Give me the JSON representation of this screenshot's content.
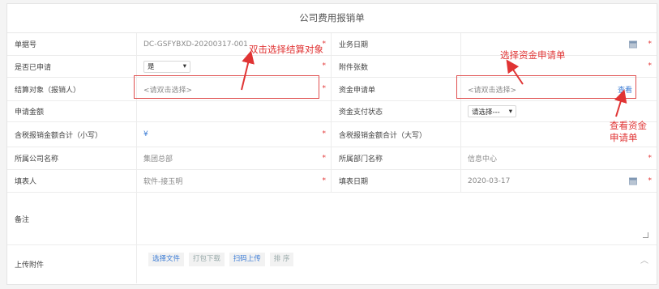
{
  "form_title": "公司费用报销单",
  "rows": {
    "r1": {
      "label_left": "单据号",
      "value_left": "DC-GSFYBXD-20200317-001",
      "label_right": "业务日期",
      "value_right": ""
    },
    "r2": {
      "label_left": "是否已申请",
      "select_value": "是",
      "label_right": "附件张数",
      "value_right": ""
    },
    "r3": {
      "label_left": "结算对象（报销人）",
      "placeholder_left": "<请双击选择>",
      "label_right": "资金申请单",
      "placeholder_right": "<请双击选择>",
      "link_right": "查看"
    },
    "r4": {
      "label_left": "申请金额",
      "label_right": "资金支付状态",
      "select_value": "请选择---"
    },
    "r5": {
      "label_left": "含税报销金额合计（小写）",
      "value_left": "¥",
      "label_right": "含税报销金额合计（大写）"
    },
    "r6": {
      "label_left": "所属公司名称",
      "value_left": "集团总部",
      "label_right": "所属部门名称",
      "value_right": "信息中心"
    },
    "r7": {
      "label_left": "填表人",
      "value_left": "软件-接玉明",
      "label_right": "填表日期",
      "value_right": "2020-03-17"
    },
    "r8": {
      "label_left": "备注"
    },
    "r9": {
      "label_left": "上传附件",
      "buttons": [
        "选择文件",
        "打包下载",
        "扫码上传",
        "排 序"
      ]
    }
  },
  "required_mark": "*",
  "annotations": {
    "a1": "双击选择结算对象",
    "a2": "选择资金申请单",
    "a3_line1": "查看资金",
    "a3_line2": "申请单"
  },
  "colors": {
    "annotation": "#e03434",
    "link": "#3a7bd5",
    "required": "#e43c3c"
  }
}
